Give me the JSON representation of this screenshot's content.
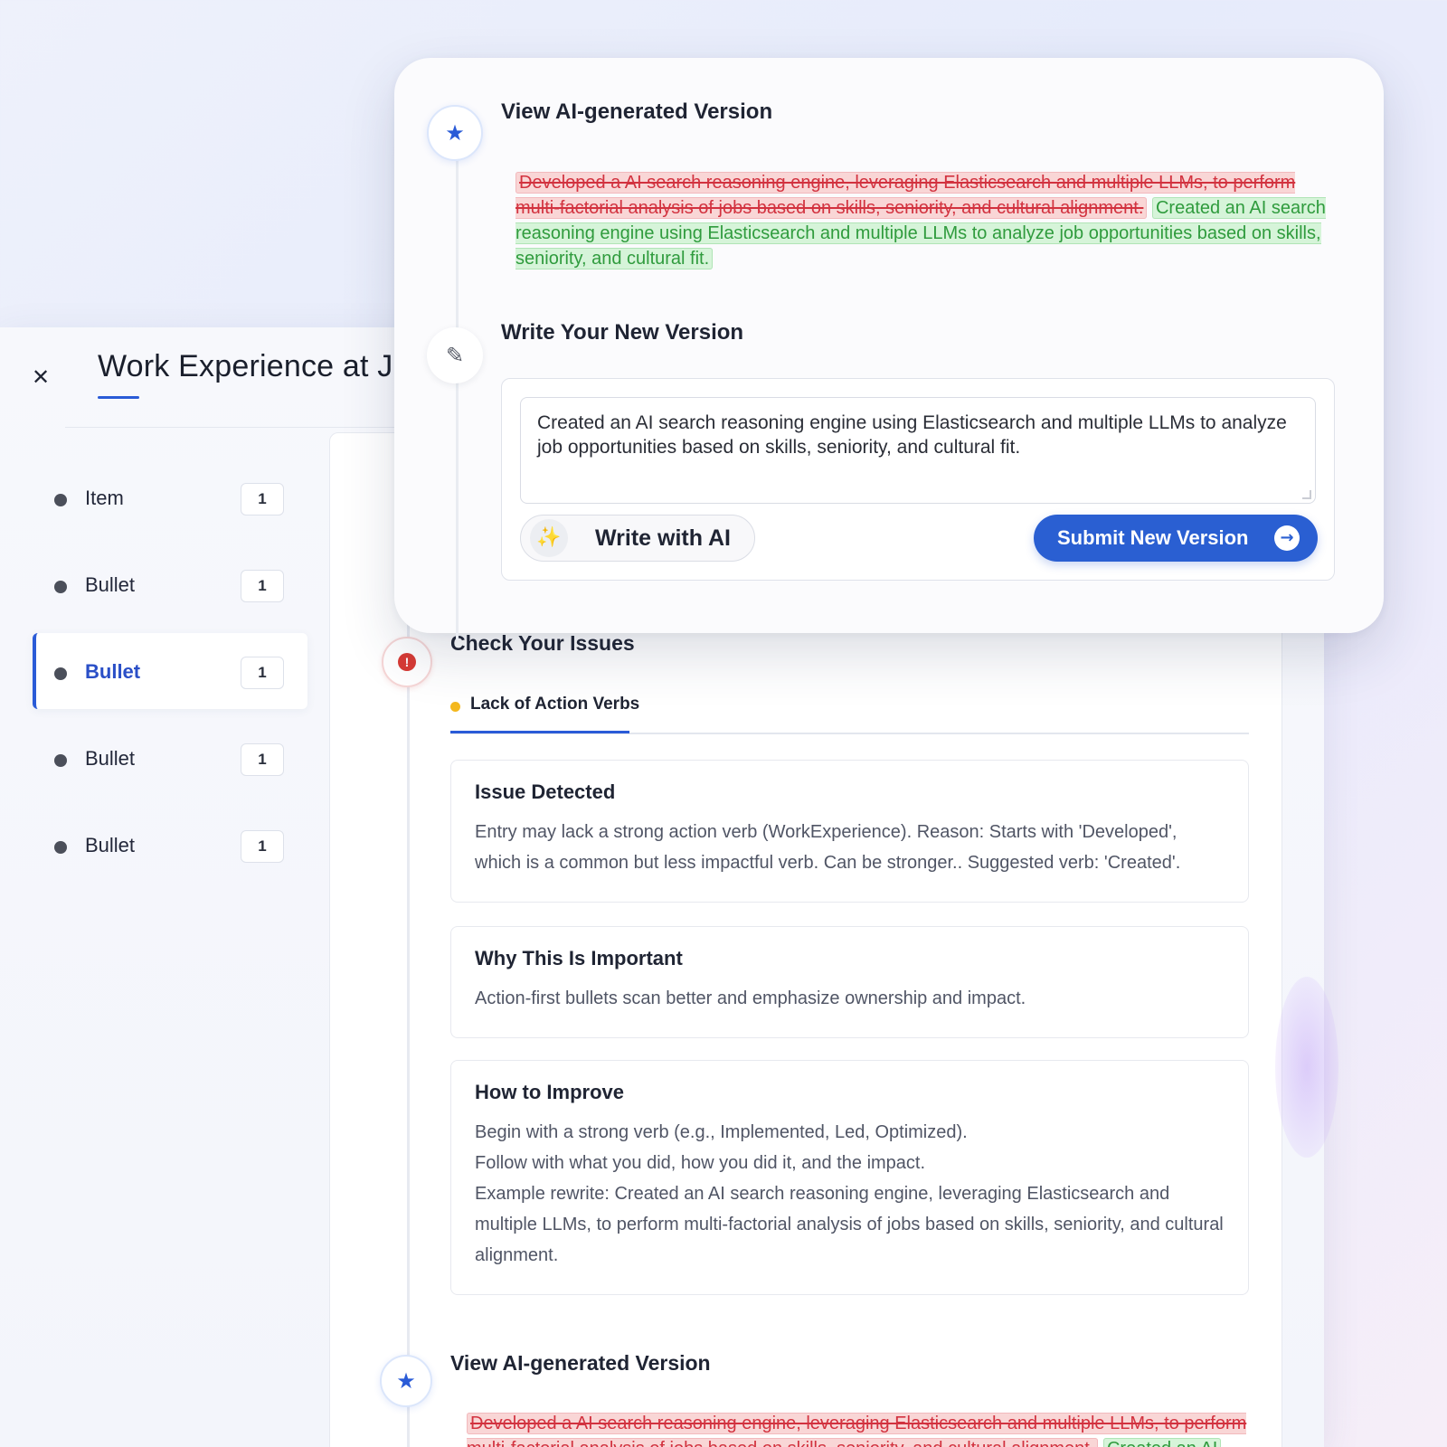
{
  "panel": {
    "close_glyph": "✕",
    "title": "Work Experience at J"
  },
  "sidebar": {
    "items": [
      {
        "label": "Item",
        "count": "1"
      },
      {
        "label": "Bullet",
        "count": "1"
      },
      {
        "label": "Bullet",
        "count": "1",
        "active": true
      },
      {
        "label": "Bullet",
        "count": "1"
      },
      {
        "label": "Bullet",
        "count": "1"
      }
    ]
  },
  "issues": {
    "title": "Check Your Issues",
    "tab_label": "Lack of Action Verbs",
    "detected_title": "Issue Detected",
    "detected_text": "Entry may lack a strong action verb (WorkExperience). Reason: Starts with 'Developed', which is a common but less impactful verb. Can be stronger.. Suggested verb: 'Created'.",
    "why_title": "Why This Is Important",
    "why_text": "Action-first bullets scan better and emphasize ownership and impact.",
    "improve_title": "How to Improve",
    "improve_line1": "Begin with a strong verb (e.g., Implemented, Led, Optimized).",
    "improve_line2": "Follow with what you did, how you did it, and the impact.",
    "improve_line3": "Example rewrite: Created an AI search reasoning engine, leveraging Elasticsearch and multiple LLMs, to perform multi-factorial analysis of jobs based on skills, seniority, and cultural alignment."
  },
  "ai_version": {
    "title": "View AI-generated Version",
    "deleted_text": "Developed a AI search reasoning engine, leveraging Elasticsearch and multiple LLMs, to perform multi-factorial analysis of jobs based on skills, seniority, and cultural alignment.",
    "inserted_text": "Created an AI search reasoning engine using Elasticsearch and multiple LLMs to analyze job opportunities based on skills, seniority, and cultural fit.",
    "bottom_deleted_text": "Developed a AI search reasoning engine, leveraging Elasticsearch and multiple LLMs, to perform multi-factorial analysis of jobs based on skills, seniority, and cultural alignment.",
    "bottom_inserted_text": "Created an AI"
  },
  "editor": {
    "title": "Write Your New Version",
    "value": "Created an AI search reasoning engine using Elasticsearch and multiple LLMs to analyze job opportunities based on skills, seniority, and cultural fit.",
    "write_ai_label": "Write with AI",
    "submit_label": "Submit New Version"
  },
  "icons": {
    "star": "★",
    "pencil": "✎",
    "alert": "!",
    "magic_wand": "✨",
    "arrow_right": "→"
  },
  "colors": {
    "accent": "#2a5fd2",
    "deleted_bg": "#f9d6d6",
    "inserted_bg": "#d6f4d9",
    "alert": "#d83a34",
    "tab_dot": "#f4b81e"
  }
}
